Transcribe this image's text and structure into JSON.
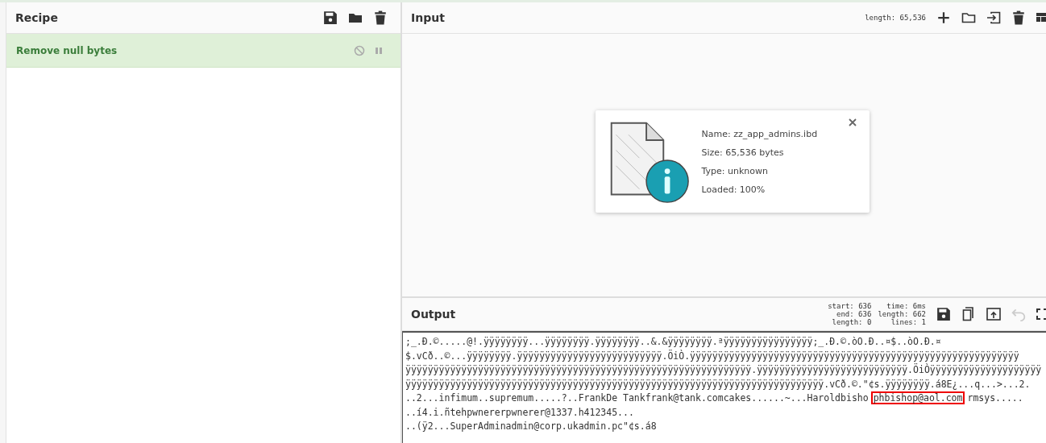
{
  "recipe": {
    "title": "Recipe",
    "operations": [
      {
        "name": "Remove null bytes",
        "disabled": false,
        "paused": false
      }
    ]
  },
  "input": {
    "title": "Input",
    "length_info": "length: 65,536",
    "file": {
      "name": "Name: zz_app_admins.ibd",
      "size": "Size: 65,536 bytes",
      "type": "Type: unknown",
      "loaded": "Loaded: 100%"
    }
  },
  "output": {
    "title": "Output",
    "stats": [
      [
        "start: 636",
        "end: 636",
        "length: 0"
      ],
      [
        "time: 6ms",
        "length: 662",
        "lines: 1"
      ]
    ],
    "undo_disabled": true,
    "lines": [
      [
        {
          "text": ";_.Đ.©.....@!.ÿÿÿÿÿÿÿÿ...ÿÿÿÿÿÿÿÿ.ÿÿÿÿÿÿÿÿ..&.&ÿÿÿÿÿÿÿÿ.ªÿÿÿÿÿÿÿÿÿÿÿÿÿÿÿÿ;_.Đ.©.òO.Đ..¤$..òO.Đ.¤",
          "boxed": false
        }
      ],
      [
        {
          "text": "$.vCð..©...ÿÿÿÿÿÿÿÿ.ÿÿÿÿÿÿÿÿÿÿÿÿÿÿÿÿÿÿÿÿÿÿÿÿÿÿ.ÖiÒ.ÿÿÿÿÿÿÿÿÿÿÿÿÿÿÿÿÿÿÿÿÿÿÿÿÿÿÿÿÿÿÿÿÿÿÿÿÿÿÿÿÿÿÿÿÿÿÿÿÿÿÿÿÿÿÿÿÿÿÿ",
          "boxed": false
        }
      ],
      [
        {
          "text": "ÿÿÿÿÿÿÿÿÿÿÿÿÿÿÿÿÿÿÿÿÿÿÿÿÿÿÿÿÿÿÿÿÿÿÿÿÿÿÿÿÿÿÿÿÿÿÿÿÿÿÿÿÿÿÿÿÿÿÿÿÿÿ.ÿÿÿÿÿÿÿÿÿÿÿÿÿÿÿÿÿÿÿÿÿÿÿÿÿÿÿ.ÖiÒÿÿÿÿÿÿÿÿÿÿÿÿÿÿÿÿÿÿÿÿ",
          "boxed": false
        }
      ],
      [
        {
          "text": "ÿÿÿÿÿÿÿÿÿÿÿÿÿÿÿÿÿÿÿÿÿÿÿÿÿÿÿÿÿÿÿÿÿÿÿÿÿÿÿÿÿÿÿÿÿÿÿÿÿÿÿÿÿÿÿÿÿÿÿÿÿÿÿÿÿÿÿÿÿÿÿÿÿÿÿ.vCð.©.\"¢s.ÿÿÿÿÿÿÿÿ.á8E¿...q...>...2.",
          "boxed": false
        }
      ],
      [
        {
          "text": "..2...infimum..supremum.....?..FrankDe Tankfrank@tank.comcakes......~...Haroldbisho",
          "boxed": false
        },
        {
          "text": "phbishop@aol.com",
          "boxed": true
        },
        {
          "text": "rmsys.....",
          "boxed": false
        }
      ],
      [
        {
          "text": "..í4.i.ñtehpwnererpwnerer@1337.h412345...",
          "boxed": false
        }
      ],
      [
        {
          "text": "..(ÿ2...SuperAdminadmin@corp.ukadmin.pc\"¢s.á8",
          "boxed": false
        }
      ]
    ]
  }
}
